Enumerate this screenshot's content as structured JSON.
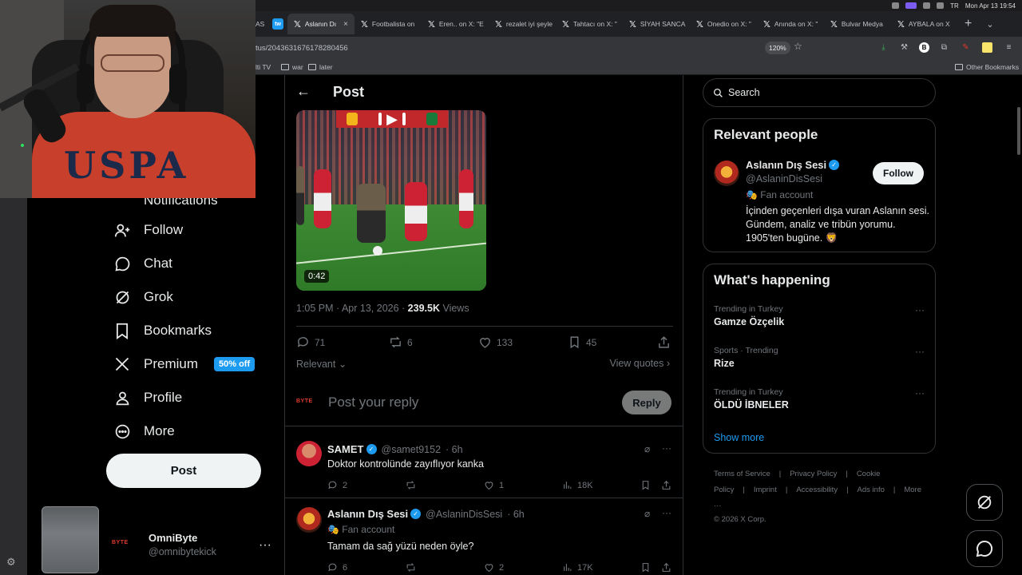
{
  "browser": {
    "tabs": [
      {
        "label": "Aslanın Dı",
        "active": true
      },
      {
        "label": "Footbalista on"
      },
      {
        "label": "Eren.. on X: \"E"
      },
      {
        "label": "rezalet iyi şeyle"
      },
      {
        "label": "Tahtacı on X: \""
      },
      {
        "label": "SİYAH SANCA"
      },
      {
        "label": "Onedio on X: \""
      },
      {
        "label": "Anında on X: \""
      },
      {
        "label": "Bulvar Medya"
      },
      {
        "label": "AYBALA on X"
      }
    ],
    "tab_prefix": "AS",
    "tw_badge": "tw",
    "url": "tus/2043631676178280456",
    "zoom": "120%",
    "bookmarks": {
      "item1": "lti TV",
      "item2": "war",
      "item3": "later",
      "other": "Other Bookmarks"
    },
    "clock": "Mon Apr 13 19:54",
    "lang": "TR"
  },
  "sidebar": {
    "partial_item": "Notifications",
    "items": [
      {
        "label": "Follow",
        "icon": "follow-icon"
      },
      {
        "label": "Chat",
        "icon": "chat-icon"
      },
      {
        "label": "Grok",
        "icon": "grok-icon"
      },
      {
        "label": "Bookmarks",
        "icon": "bookmark-icon"
      },
      {
        "label": "Premium",
        "icon": "x-logo-icon"
      },
      {
        "label": "Profile",
        "icon": "profile-icon"
      },
      {
        "label": "More",
        "icon": "more-icon"
      }
    ],
    "premium_badge": "50% off",
    "post_label": "Post",
    "account": {
      "name": "OmniByte",
      "handle": "@omnibytekick",
      "avatar_text": "BYTE"
    }
  },
  "main": {
    "header_title": "Post",
    "video_duration": "0:42",
    "timestamp": "1:05 PM · Apr 13, 2026 · ",
    "views_count": "239.5K",
    "views_label": " Views",
    "actions": {
      "replies": "71",
      "reposts": "6",
      "likes": "133",
      "bookmarks": "45"
    },
    "relevant_label": "Relevant",
    "view_quotes": "View quotes",
    "reply_placeholder": "Post your reply",
    "reply_button": "Reply",
    "compose_avatar_text": "BYTE",
    "replies": [
      {
        "name": "SAMET",
        "handle": "@samet9152",
        "time": "· 6h",
        "text": "Doktor kontrolünde zayıflıyor kanka",
        "replies": "2",
        "reposts": "",
        "likes": "1",
        "views": "18K"
      },
      {
        "name": "Aslanın Dış Sesi",
        "handle": "@AslaninDisSesi",
        "time": "· 6h",
        "fan": "Fan account",
        "text": "Tamam da sağ yüzü neden öyle?",
        "replies": "6",
        "reposts": "",
        "likes": "2",
        "views": "17K"
      }
    ]
  },
  "right": {
    "search_placeholder": "Search",
    "relevant_people_title": "Relevant people",
    "person": {
      "name": "Aslanın Dış Sesi",
      "handle": "@AslaninDisSesi",
      "fan": "Fan account",
      "bio": "İçinden geçenleri dışa vuran Aslanın sesi. Gündem, analiz ve tribün yorumu. 1905'ten bugüne. 🦁",
      "follow_label": "Follow"
    },
    "whats_happening_title": "What's happening",
    "trends": [
      {
        "category": "Trending in Turkey",
        "name": "Gamze Özçelik"
      },
      {
        "category": "Sports · Trending",
        "name": "Rize"
      },
      {
        "category": "Trending in Turkey",
        "name": "ÖLDÜ İBNELER"
      }
    ],
    "show_more": "Show more",
    "footer": [
      "Terms of Service",
      "|",
      "Privacy Policy",
      "|",
      "Cookie Policy",
      "|",
      "Imprint",
      "|",
      "Accessibility",
      "|",
      "Ads info",
      "|",
      "More ···",
      "© 2026 X Corp."
    ]
  },
  "colors": {
    "accent": "#1d9bf0",
    "bg": "#000000",
    "text": "#e7e9ea",
    "muted": "#71767b",
    "border": "#2f3336"
  }
}
